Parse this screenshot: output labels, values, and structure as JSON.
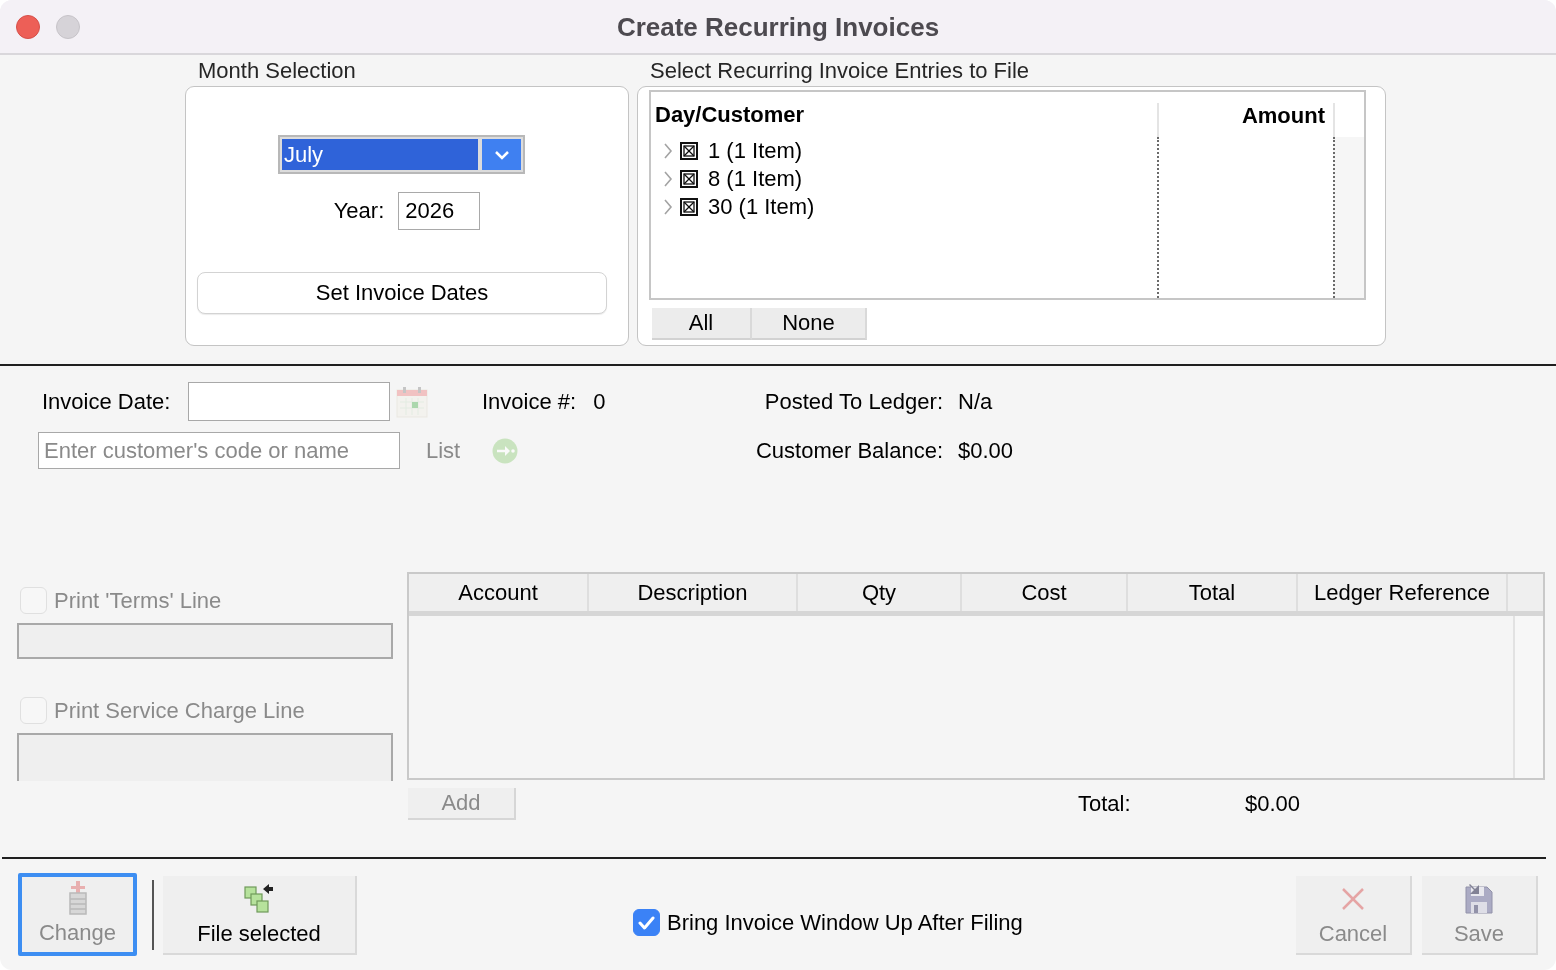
{
  "window": {
    "title": "Create Recurring Invoices"
  },
  "month_selection": {
    "label": "Month Selection",
    "month": {
      "value": "July",
      "focused": true
    },
    "year": {
      "label": "Year:",
      "value": "2026"
    },
    "set_dates_button": "Set Invoice Dates"
  },
  "entries": {
    "label": "Select Recurring Invoice Entries to File",
    "columns": [
      "Day/Customer",
      "Amount"
    ],
    "rows": [
      {
        "label": "1 (1 Item)",
        "checked": true,
        "expanded": false
      },
      {
        "label": "8 (1 Item)",
        "checked": true,
        "expanded": false
      },
      {
        "label": "30 (1 Item)",
        "checked": true,
        "expanded": false
      }
    ],
    "buttons": [
      "All",
      "None"
    ]
  },
  "invoice": {
    "date_label": "Invoice Date:",
    "number_label": "Invoice #:",
    "number": "0",
    "posted_label": "Posted To Ledger:",
    "posted": "N/a",
    "customer_field": {
      "placeholder": "Enter customer's code or name"
    },
    "list_button": {
      "label": "List",
      "disabled": true
    },
    "balance_label": "Customer Balance:",
    "balance": "$0.00"
  },
  "options": [
    {
      "label": "Print 'Terms' Line",
      "checked": false,
      "disabled": true
    },
    {
      "label": "Print Service Charge Line",
      "checked": false,
      "disabled": true
    }
  ],
  "line_items": {
    "columns": [
      "Account",
      "Description",
      "Qty",
      "Cost",
      "Total",
      "Ledger Reference"
    ],
    "add_button": {
      "label": "Add",
      "disabled": true
    },
    "total_label": "Total:",
    "total": "$0.00"
  },
  "toolbar": {
    "left_buttons": [
      {
        "kind": "change",
        "label": "Change",
        "disabled": true,
        "focused": true
      },
      {
        "kind": "file",
        "label": "File selected",
        "disabled": false,
        "focused": false
      }
    ],
    "bring_up": {
      "label": "Bring Invoice Window Up After Filing",
      "checked": true
    },
    "right_buttons": [
      {
        "kind": "cancel",
        "label": "Cancel",
        "disabled": true,
        "focused": false
      },
      {
        "kind": "save",
        "label": "Save",
        "disabled": true,
        "focused": false
      }
    ]
  }
}
